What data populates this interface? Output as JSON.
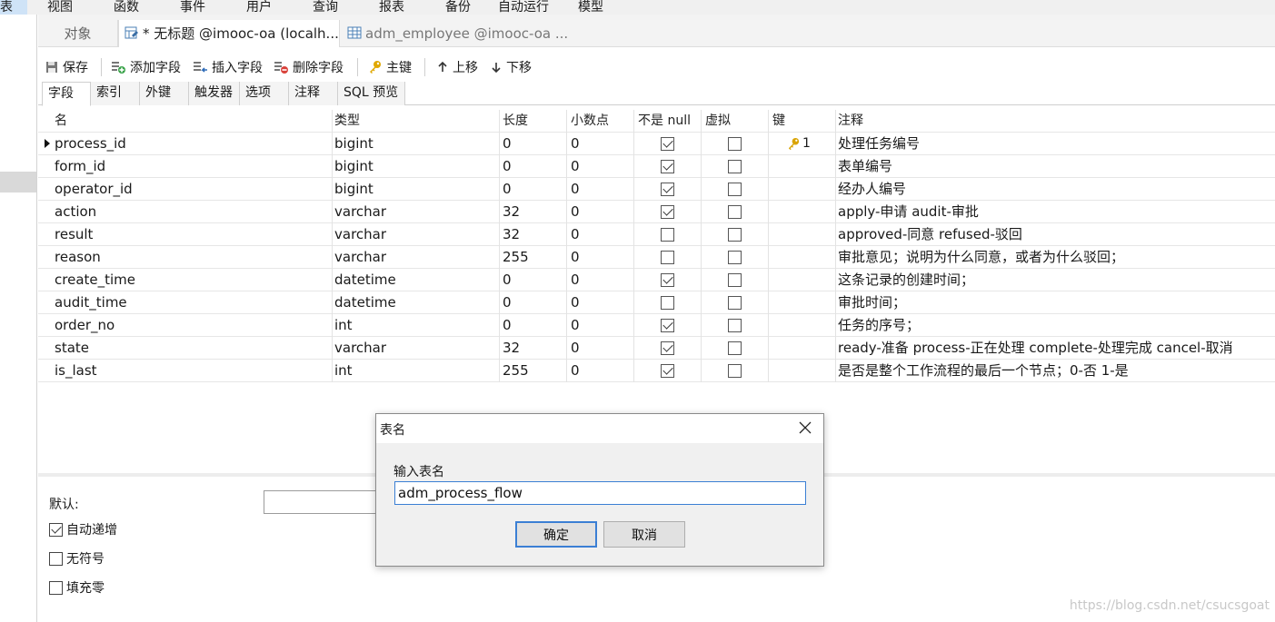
{
  "menu": {
    "stub": "表",
    "items": [
      "视图",
      "函数",
      "事件",
      "用户",
      "查询",
      "报表",
      "备份",
      "自动运行",
      "模型"
    ]
  },
  "tabs": {
    "objects": "对象",
    "active": "* 无标题 @imooc-oa (localh...",
    "second": "adm_employee @imooc-oa ..."
  },
  "toolbar": {
    "save": "保存",
    "add_field": "添加字段",
    "insert_field": "插入字段",
    "delete_field": "删除字段",
    "primary_key": "主键",
    "move_up": "上移",
    "move_down": "下移"
  },
  "subtabs": [
    "字段",
    "索引",
    "外键",
    "触发器",
    "选项",
    "注释",
    "SQL 预览"
  ],
  "grid": {
    "headers": [
      "名",
      "类型",
      "长度",
      "小数点",
      "不是 null",
      "虚拟",
      "键",
      "注释"
    ],
    "rows": [
      {
        "name": "process_id",
        "type": "bigint",
        "length": "0",
        "decimals": "0",
        "not_null": true,
        "virtual": false,
        "key": "1",
        "comment": "处理任务编号"
      },
      {
        "name": "form_id",
        "type": "bigint",
        "length": "0",
        "decimals": "0",
        "not_null": true,
        "virtual": false,
        "key": "",
        "comment": "表单编号"
      },
      {
        "name": "operator_id",
        "type": "bigint",
        "length": "0",
        "decimals": "0",
        "not_null": true,
        "virtual": false,
        "key": "",
        "comment": "经办人编号"
      },
      {
        "name": "action",
        "type": "varchar",
        "length": "32",
        "decimals": "0",
        "not_null": true,
        "virtual": false,
        "key": "",
        "comment": "apply-申请 audit-审批"
      },
      {
        "name": "result",
        "type": "varchar",
        "length": "32",
        "decimals": "0",
        "not_null": false,
        "virtual": false,
        "key": "",
        "comment": "approved-同意 refused-驳回"
      },
      {
        "name": "reason",
        "type": "varchar",
        "length": "255",
        "decimals": "0",
        "not_null": false,
        "virtual": false,
        "key": "",
        "comment": "审批意见；说明为什么同意，或者为什么驳回；"
      },
      {
        "name": "create_time",
        "type": "datetime",
        "length": "0",
        "decimals": "0",
        "not_null": true,
        "virtual": false,
        "key": "",
        "comment": "这条记录的创建时间；"
      },
      {
        "name": "audit_time",
        "type": "datetime",
        "length": "0",
        "decimals": "0",
        "not_null": false,
        "virtual": false,
        "key": "",
        "comment": "审批时间；"
      },
      {
        "name": "order_no",
        "type": "int",
        "length": "0",
        "decimals": "0",
        "not_null": true,
        "virtual": false,
        "key": "",
        "comment": "任务的序号；"
      },
      {
        "name": "state",
        "type": "varchar",
        "length": "32",
        "decimals": "0",
        "not_null": true,
        "virtual": false,
        "key": "",
        "comment": "ready-准备 process-正在处理 complete-处理完成 cancel-取消"
      },
      {
        "name": "is_last",
        "type": "int",
        "length": "255",
        "decimals": "0",
        "not_null": true,
        "virtual": false,
        "key": "",
        "comment": "是否是整个工作流程的最后一个节点；0-否 1-是"
      }
    ]
  },
  "lower": {
    "default_label": "默认:",
    "auto_increment": {
      "label": "自动递增",
      "checked": true
    },
    "unsigned": {
      "label": "无符号",
      "checked": false
    },
    "zerofill": {
      "label": "填充零",
      "checked": false
    }
  },
  "dialog": {
    "title": "表名",
    "label": "输入表名",
    "value": "adm_process_flow",
    "ok": "确定",
    "cancel": "取消"
  },
  "watermark": "https://blog.csdn.net/csucsgoat",
  "colors": {
    "accent": "#3b7fd4",
    "key": "#d9a300"
  }
}
